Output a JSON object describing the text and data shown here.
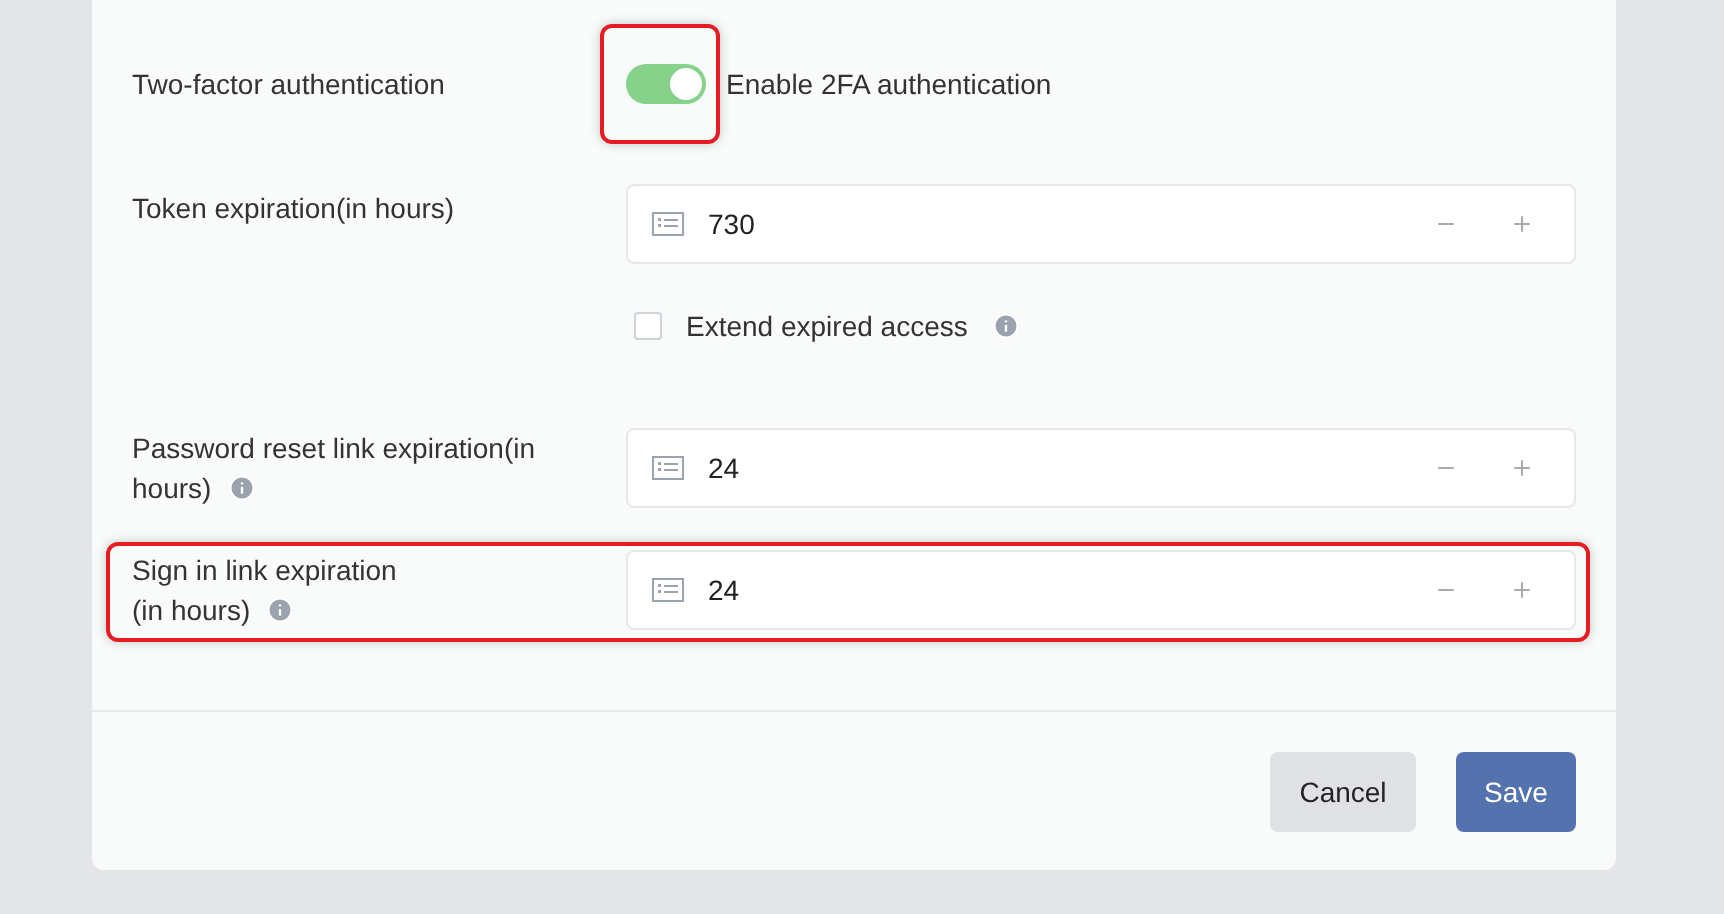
{
  "two_factor": {
    "label": "Two-factor authentication",
    "toggle_label": "Enable 2FA authentication",
    "on": true,
    "highlighted": true
  },
  "token_expiration": {
    "label": "Token expiration(in hours)",
    "value": "730"
  },
  "extend_expired": {
    "label": "Extend expired access",
    "checked": false
  },
  "password_reset": {
    "label_lines": [
      "Password reset link expiration(in",
      "hours)"
    ],
    "value": "24"
  },
  "sign_in_link": {
    "label_lines": [
      "Sign in link expiration",
      "(in hours)"
    ],
    "value": "24",
    "highlighted": true
  },
  "buttons": [
    {
      "label": "Cancel",
      "kind": "secondary"
    },
    {
      "label": "Save",
      "kind": "primary"
    }
  ]
}
